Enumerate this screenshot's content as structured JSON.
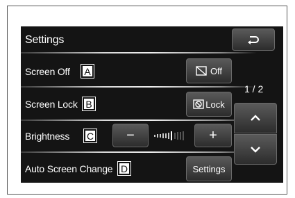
{
  "header": {
    "title": "Settings",
    "back_icon": "back-arrow-icon"
  },
  "rows": [
    {
      "label": "Screen Off",
      "tag": "A",
      "button_label": "Off",
      "button_icon": "screen-off-icon"
    },
    {
      "label": "Screen Lock",
      "tag": "B",
      "button_label": "Lock",
      "button_icon": "lock-icon"
    },
    {
      "label": "Brightness",
      "tag": "C",
      "minus_label": "−",
      "plus_label": "+"
    },
    {
      "label": "Auto Screen Change",
      "tag": "D",
      "button_label": "Settings"
    }
  ],
  "pager": {
    "indicator": "1 / 2",
    "up_icon": "chevron-up-icon",
    "down_icon": "chevron-down-icon"
  },
  "colors": {
    "screen_bg": "#141414",
    "button_top": "#5a5a5a",
    "button_bottom": "#2c2c2c",
    "text": "#ffffff"
  }
}
